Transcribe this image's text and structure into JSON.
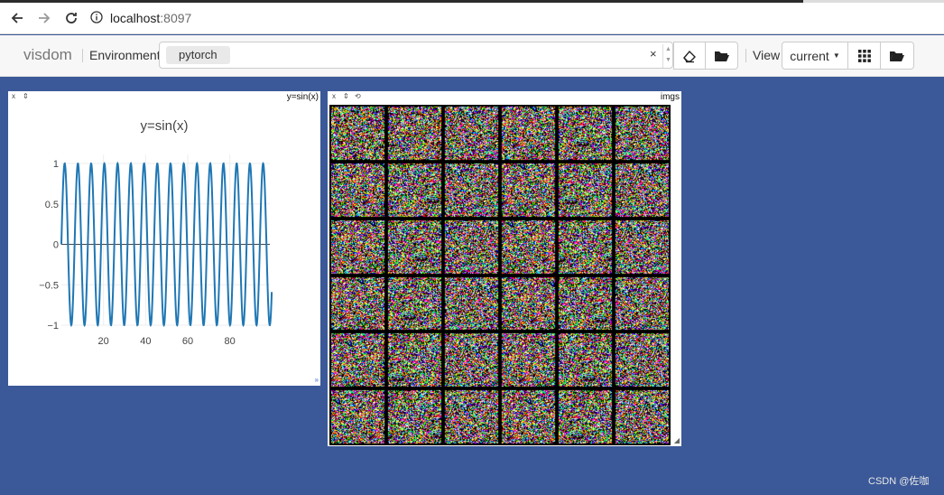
{
  "browser": {
    "url_host": "localhost",
    "url_port": ":8097"
  },
  "toolbar": {
    "brand": "visdom",
    "env_label": "Environment",
    "env_selected": "pytorch",
    "env_clear": "×",
    "view_label": "View",
    "view_selected": "current",
    "icons": [
      "eraser-icon",
      "folder-open-icon",
      "grid-icon",
      "folder-open-icon"
    ]
  },
  "panes": {
    "plot": {
      "controls": [
        "x",
        "⇕"
      ],
      "title_tag": "y=sin(x)",
      "chart_title": "y=sin(x)"
    },
    "images": {
      "controls": [
        "x",
        "⇕",
        "⟲"
      ],
      "title_tag": "imgs",
      "rows": 6,
      "cols": 6
    }
  },
  "chart_data": {
    "type": "line",
    "title": "y=sin(x)",
    "xlabel": "",
    "ylabel": "",
    "x_ticks": [
      20,
      40,
      60,
      80
    ],
    "y_ticks": [
      1,
      0.5,
      0,
      -0.5,
      -1
    ],
    "y_tick_labels": [
      "1",
      "0.5",
      "0",
      "−0.5",
      "−1"
    ],
    "xlim": [
      0,
      99
    ],
    "ylim": [
      -1,
      1
    ],
    "series": [
      {
        "x_start": 0,
        "x_end": 99.9,
        "step": 0.1,
        "function": "sin(x)",
        "color": "#1f77b4"
      }
    ]
  },
  "colors": {
    "background": "#3b5998",
    "line": "#1f77b4"
  },
  "watermark": "CSDN @佐咖"
}
